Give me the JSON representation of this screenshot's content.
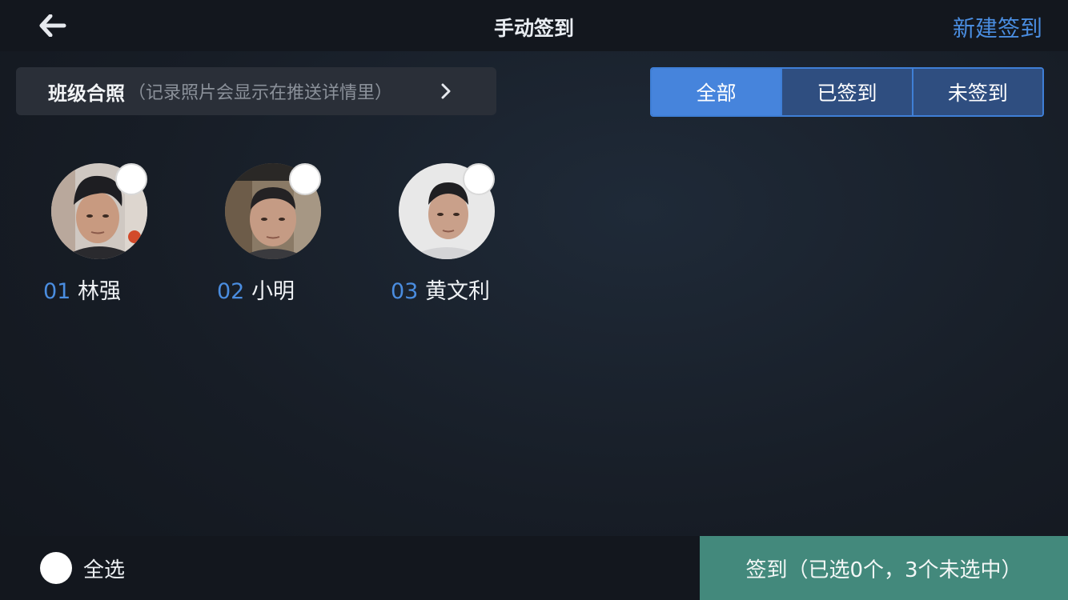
{
  "header": {
    "title": "手动签到",
    "back_icon": "arrow-left-icon",
    "new_label": "新建签到"
  },
  "photo": {
    "label": "班级合照",
    "hint": "（记录照片会显示在推送详情里）",
    "chevron_icon": "chevron-right-icon"
  },
  "filters": {
    "tabs": [
      {
        "label": "全部",
        "active": true
      },
      {
        "label": "已签到",
        "active": false
      },
      {
        "label": "未签到",
        "active": false
      }
    ]
  },
  "students": [
    {
      "number": "01",
      "name": "林强",
      "selected": false
    },
    {
      "number": "02",
      "name": "小明",
      "selected": false
    },
    {
      "number": "03",
      "name": "黄文利",
      "selected": false
    }
  ],
  "footer": {
    "select_all_label": "全选",
    "submit_label": "签到（已选0个，3个未选中）"
  },
  "colors": {
    "accent": "#4a8de0",
    "submit": "#43897c",
    "segment_active": "#4684dc",
    "segment_inactive": "#2f4e80"
  }
}
